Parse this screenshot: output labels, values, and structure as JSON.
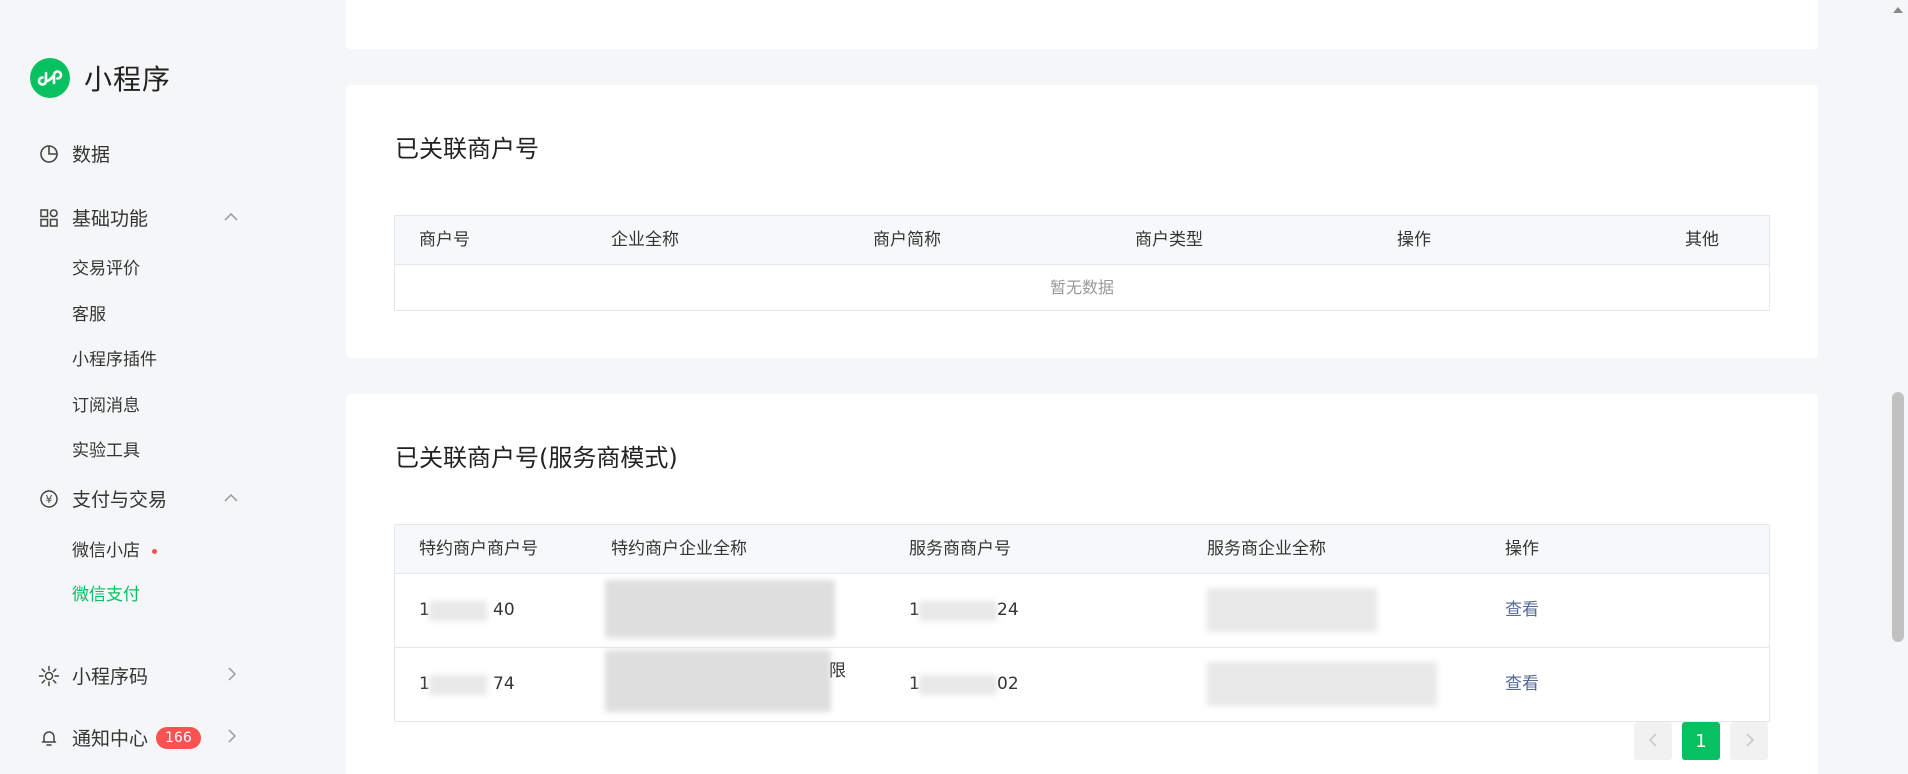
{
  "brand": {
    "name": "小程序"
  },
  "sidebar": {
    "data": "数据",
    "basic": {
      "label": "基础功能",
      "items": [
        "交易评价",
        "客服",
        "小程序插件",
        "订阅消息",
        "实验工具"
      ]
    },
    "pay": {
      "label": "支付与交易",
      "items": [
        "微信小店",
        "微信支付"
      ]
    },
    "qrcode": "小程序码",
    "notify": {
      "label": "通知中心",
      "badge": "166"
    }
  },
  "merchants": {
    "title": "已关联商户号",
    "columns": [
      "商户号",
      "企业全称",
      "商户简称",
      "商户类型",
      "操作",
      "其他"
    ],
    "empty_text": "暂无数据"
  },
  "service_merchants": {
    "title": "已关联商户号(服务商模式)",
    "columns": [
      "特约商户商户号",
      "特约商户企业全称",
      "服务商商户号",
      "服务商企业全称",
      "操作"
    ],
    "rows": [
      {
        "sub_id_start": "1",
        "sub_id_end": "40",
        "sub_name_tail": "",
        "sp_id_start": "1",
        "sp_id_end": "24",
        "action": "查看"
      },
      {
        "sub_id_start": "1",
        "sub_id_end": "74",
        "sub_name_tail": "限",
        "sp_id_start": "1",
        "sp_id_end": "02",
        "action": "查看"
      }
    ]
  },
  "pagination": {
    "current": "1",
    "prev_icon": "chevron-left-icon",
    "next_icon": "chevron-right-icon"
  },
  "colors": {
    "brand": "#07c160",
    "link": "#576b95",
    "badge": "#fa5151"
  }
}
